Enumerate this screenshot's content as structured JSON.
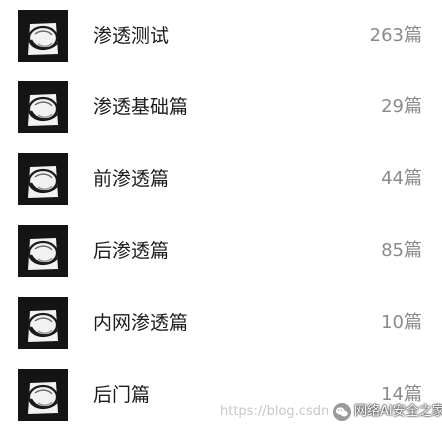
{
  "items": [
    {
      "label": "渗透测试",
      "count": "263篇",
      "icon": "hacker-hat-avatar-icon"
    },
    {
      "label": "渗透基础篇",
      "count": "29篇",
      "icon": "hacker-hat-avatar-icon"
    },
    {
      "label": "前渗透篇",
      "count": "44篇",
      "icon": "hacker-hat-avatar-icon"
    },
    {
      "label": "后渗透篇",
      "count": "85篇",
      "icon": "hacker-hat-avatar-icon"
    },
    {
      "label": "内网渗透篇",
      "count": "10篇",
      "icon": "hacker-hat-avatar-icon"
    },
    {
      "label": "后门篇",
      "count": "14篇",
      "icon": "hacker-hat-avatar-icon"
    }
  ],
  "watermark": {
    "url": "https://blog.csdn",
    "name": "网络AI安全之家",
    "icon": "wechat-icon"
  }
}
